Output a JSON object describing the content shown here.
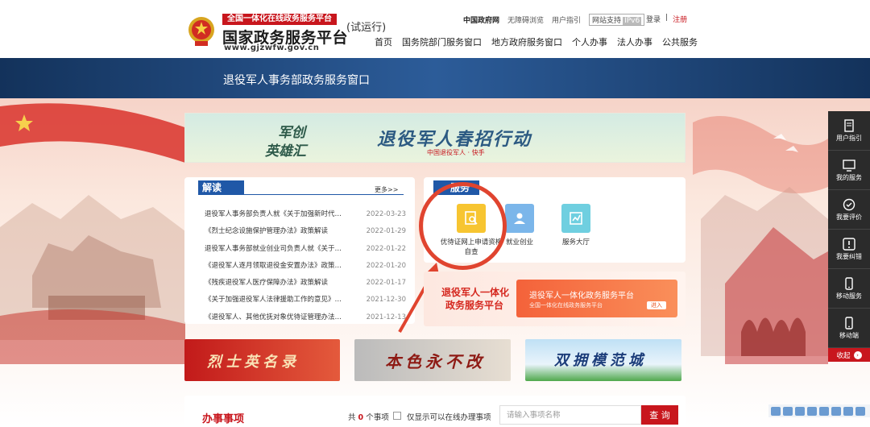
{
  "header": {
    "brand_tagline": "全国一体化在线政务服务平台",
    "brand_title": "国家政务服务平台",
    "brand_url": "www.gjzwfw.gov.cn",
    "brand_trial": "(试运行)",
    "top_links": {
      "gov": "中国政府网",
      "accessible": "无障碍浏览",
      "guide": "用户指引",
      "ipv6_label": "网站支持",
      "ipv6_badge": "IPv6"
    },
    "login": "登录",
    "divider": "|",
    "register": "注册",
    "nav": [
      "首页",
      "国务院部门服务窗口",
      "地方政府服务窗口",
      "个人办事",
      "法人办事",
      "公共服务"
    ]
  },
  "banner_title": "退役军人事务部政务服务窗口",
  "promo": {
    "line1": "军创",
    "line2": "英雄汇",
    "line3": "退役军人春招行动",
    "org": "中国退役军人 · 快手"
  },
  "jiedu": {
    "title": "解读",
    "more": "更多>>",
    "items": [
      {
        "title": "退役军人事务部负责人就《关于加强新时代退役军人就业创业工作的意见》答记者问",
        "date": "2022-03-23"
      },
      {
        "title": "《烈士纪念设施保护管理办法》政策解读",
        "date": "2022-01-29"
      },
      {
        "title": "退役军人事务部就业创业司负责人就《关于进一步做好退役军人就业创业工作》答记者问",
        "date": "2022-01-22"
      },
      {
        "title": "《退役军人逐月领取退役金安置办法》政策解读",
        "date": "2022-01-20"
      },
      {
        "title": "《残疾退役军人医疗保障办法》政策解读",
        "date": "2022-01-17"
      },
      {
        "title": "《关于加强退役军人法律援助工作的意见》政策解读",
        "date": "2021-12-30"
      },
      {
        "title": "《退役军人、其他优抚对象优待证管理办法（试行）》政策解读",
        "date": "2021-12-13"
      }
    ]
  },
  "fuwu": {
    "title": "服务",
    "services": [
      {
        "label": "优待证网上申请资格自查",
        "icon": "search-document-icon",
        "color": "#f7c531"
      },
      {
        "label": "就业创业",
        "icon": "employment-icon",
        "color": "#7bb6ea"
      },
      {
        "label": "服务大厅",
        "icon": "service-hall-icon",
        "color": "#6fcfe0"
      }
    ]
  },
  "platform": {
    "line1": "退役军人一体化",
    "line2": "政务服务平台",
    "card_title": "退役军人一体化政务服务平台",
    "card_sub": "全国一体化在线政务服务平台",
    "card_btn": "进入"
  },
  "bottom_banners": [
    "烈士英名录",
    "本色永不改",
    "双拥模范城"
  ],
  "banshi": {
    "title": "办事事项",
    "count_prefix": "共",
    "count": "0",
    "count_suffix": "个事项",
    "online_only": "仅显示可以在线办理事项",
    "search_placeholder": "请输入事项名称",
    "search_button": "查 询"
  },
  "sidebar": {
    "items": [
      {
        "label": "用户指引",
        "icon": "guide-icon"
      },
      {
        "label": "我的服务",
        "icon": "my-service-icon"
      },
      {
        "label": "我要评价",
        "icon": "evaluate-icon"
      },
      {
        "label": "我要纠错",
        "icon": "report-error-icon"
      },
      {
        "label": "移动服务",
        "icon": "mobile-service-icon"
      },
      {
        "label": "移动端",
        "icon": "mobile-icon"
      }
    ],
    "collapse": "收起"
  }
}
